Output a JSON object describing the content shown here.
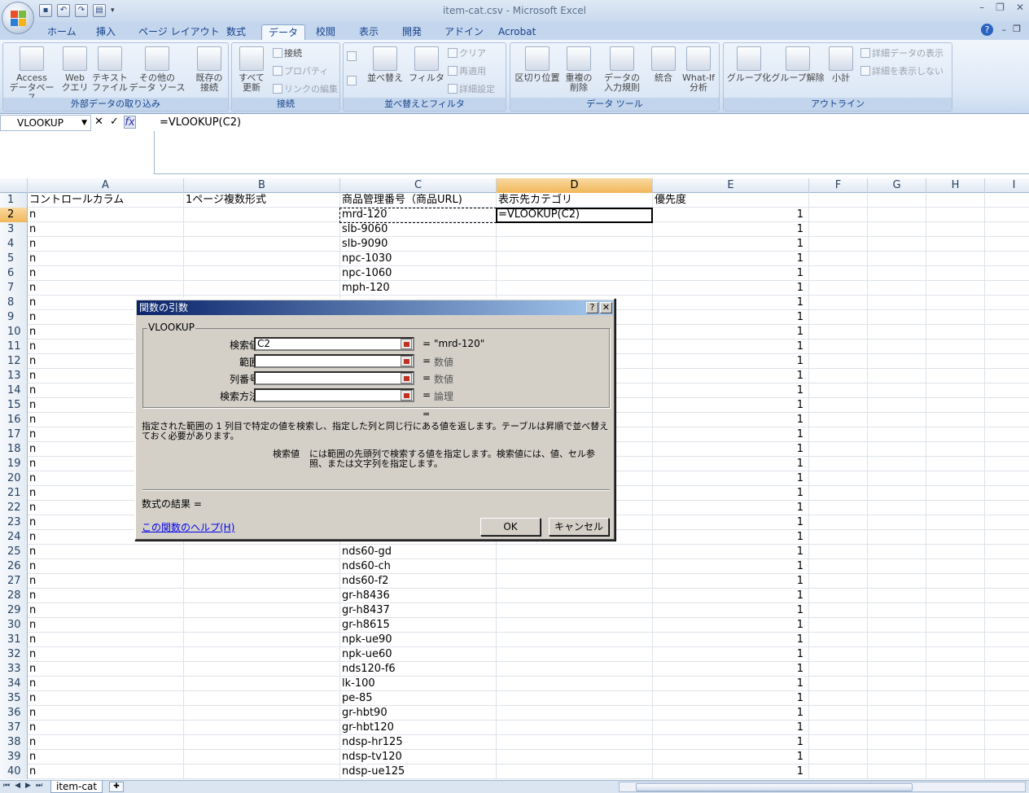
{
  "window": {
    "title": "item-cat.csv - Microsoft Excel"
  },
  "tabs": [
    "ホーム",
    "挿入",
    "ページ レイアウト",
    "数式",
    "データ",
    "校閲",
    "表示",
    "開発",
    "アドイン",
    "Acrobat"
  ],
  "ribbon": {
    "groups": [
      "外部データの取り込み",
      "接続",
      "並べ替えとフィルタ",
      "データ ツール",
      "アウトライン"
    ],
    "ext": {
      "access": "Access\nデータベース",
      "web": "Web\nクエリ",
      "text": "テキスト\nファイル",
      "other": "その他の\nデータ ソース",
      "existing": "既存の\n接続"
    },
    "conn": {
      "refresh": "すべて\n更新",
      "connections": "接続",
      "properties": "プロパティ",
      "edit_links": "リンクの編集"
    },
    "sort": {
      "sort": "並べ替え",
      "filter": "フィルタ",
      "clear": "クリア",
      "reapply": "再適用",
      "advanced": "詳細設定"
    },
    "tools": {
      "text_to_columns": "区切り位置",
      "remove_dup": "重複の\n削除",
      "validation": "データの\n入力規則",
      "consolidate": "統合",
      "whatif": "What-If\n分析"
    },
    "outline": {
      "group": "グループ化",
      "ungroup": "グループ解除",
      "subtotal": "小計",
      "show_detail": "詳細データの表示",
      "hide_detail": "詳細を表示しない"
    }
  },
  "formula_bar": {
    "name_box": "VLOOKUP",
    "formula": "=VLOOKUP(C2)"
  },
  "columns": [
    "A",
    "B",
    "C",
    "D",
    "E",
    "F",
    "G",
    "H",
    "I"
  ],
  "rows": [
    [
      "1",
      "コントロールカラム",
      "1ページ複数形式",
      "商品管理番号（商品URL)",
      "表示先カテゴリ",
      "優先度"
    ],
    [
      "2",
      "n",
      "",
      "mrd-120",
      "=VLOOKUP(C2)",
      "1"
    ],
    [
      "3",
      "n",
      "",
      "slb-9060",
      "",
      "1"
    ],
    [
      "4",
      "n",
      "",
      "slb-9090",
      "",
      "1"
    ],
    [
      "5",
      "n",
      "",
      "npc-1030",
      "",
      "1"
    ],
    [
      "6",
      "n",
      "",
      "npc-1060",
      "",
      "1"
    ],
    [
      "7",
      "n",
      "",
      "mph-120",
      "",
      "1"
    ],
    [
      "8",
      "n",
      "",
      "",
      "",
      "1"
    ],
    [
      "9",
      "n",
      "",
      "",
      "",
      "1"
    ],
    [
      "10",
      "n",
      "",
      "",
      "",
      "1"
    ],
    [
      "11",
      "n",
      "",
      "",
      "",
      "1"
    ],
    [
      "12",
      "n",
      "",
      "",
      "",
      "1"
    ],
    [
      "13",
      "n",
      "",
      "",
      "",
      "1"
    ],
    [
      "14",
      "n",
      "",
      "",
      "",
      "1"
    ],
    [
      "15",
      "n",
      "",
      "",
      "",
      "1"
    ],
    [
      "16",
      "n",
      "",
      "",
      "",
      "1"
    ],
    [
      "17",
      "n",
      "",
      "",
      "",
      "1"
    ],
    [
      "18",
      "n",
      "",
      "",
      "",
      "1"
    ],
    [
      "19",
      "n",
      "",
      "",
      "",
      "1"
    ],
    [
      "20",
      "n",
      "",
      "",
      "",
      "1"
    ],
    [
      "21",
      "n",
      "",
      "",
      "",
      "1"
    ],
    [
      "22",
      "n",
      "",
      "",
      "",
      "1"
    ],
    [
      "23",
      "n",
      "",
      "",
      "",
      "1"
    ],
    [
      "24",
      "n",
      "",
      "",
      "",
      "1"
    ],
    [
      "25",
      "n",
      "",
      "nds60-gd",
      "",
      "1"
    ],
    [
      "26",
      "n",
      "",
      "nds60-ch",
      "",
      "1"
    ],
    [
      "27",
      "n",
      "",
      "nds60-f2",
      "",
      "1"
    ],
    [
      "28",
      "n",
      "",
      "gr-h8436",
      "",
      "1"
    ],
    [
      "29",
      "n",
      "",
      "gr-h8437",
      "",
      "1"
    ],
    [
      "30",
      "n",
      "",
      "gr-h8615",
      "",
      "1"
    ],
    [
      "31",
      "n",
      "",
      "npk-ue90",
      "",
      "1"
    ],
    [
      "32",
      "n",
      "",
      "npk-ue60",
      "",
      "1"
    ],
    [
      "33",
      "n",
      "",
      "nds120-f6",
      "",
      "1"
    ],
    [
      "34",
      "n",
      "",
      "lk-100",
      "",
      "1"
    ],
    [
      "35",
      "n",
      "",
      "pe-85",
      "",
      "1"
    ],
    [
      "36",
      "n",
      "",
      "gr-hbt90",
      "",
      "1"
    ],
    [
      "37",
      "n",
      "",
      "gr-hbt120",
      "",
      "1"
    ],
    [
      "38",
      "n",
      "",
      "ndsp-hr125",
      "",
      "1"
    ],
    [
      "39",
      "n",
      "",
      "ndsp-tv120",
      "",
      "1"
    ],
    [
      "40",
      "n",
      "",
      "ndsp-ue125",
      "",
      "1"
    ]
  ],
  "sheet_tab": "item-cat",
  "dialog": {
    "title": "関数の引数",
    "help_btn": "?",
    "close_btn": "✕",
    "function_name": "VLOOKUP",
    "args": [
      {
        "label": "検索値",
        "value": "C2",
        "result": "\"mrd-120\""
      },
      {
        "label": "範囲",
        "value": "",
        "result": "数値"
      },
      {
        "label": "列番号",
        "value": "",
        "result": "数値"
      },
      {
        "label": "検索方法",
        "value": "",
        "result": "論理"
      }
    ],
    "eq": "=",
    "result_eq": "=",
    "description": "指定された範囲の 1 列目で特定の値を検索し、指定した列と同じ行にある値を返します。テーブルは昇順で並べ替えておく必要があります。",
    "arg_name": "検索値",
    "arg_desc": "には範囲の先頭列で検索する値を指定します。検索値には、値、セル参照、または文字列を指定します。",
    "formula_result": "数式の結果 =",
    "help_link": "この関数のヘルプ(H)",
    "ok": "OK",
    "cancel": "キャンセル"
  }
}
